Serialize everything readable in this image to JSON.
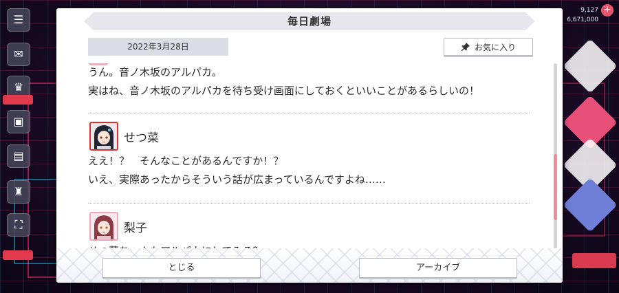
{
  "modal": {
    "title": "毎日劇場",
    "date": "2022年3月28日",
    "favorite_label": "お気に入り"
  },
  "dialogue": [
    {
      "speaker": "",
      "lines": [
        "うん。音ノ木坂のアルパカ。",
        "実はね、音ノ木坂のアルパカを待ち受け画面にしておくといいことがあるらしいの！"
      ]
    },
    {
      "speaker": "せつ菜",
      "avatar": "setsuna-avatar",
      "lines": [
        "ええ！？　そんなことがあるんですか！？",
        "いえ、実際あったからそういう話が広まっているんですよね……"
      ]
    },
    {
      "speaker": "梨子",
      "avatar": "riko-avatar",
      "lines": [
        "せつ菜ちゃんもアルパカにしてみる？"
      ]
    }
  ],
  "buttons": {
    "close_label": "とじる",
    "archive_label": "アーカイブ"
  },
  "background": {
    "stat_1": "9,127",
    "stat_2": "6,671,000"
  },
  "colors": {
    "accent_pink": "#ef8a97",
    "setsuna_frame": "#d8312f",
    "riko_frame": "#f0a7b3"
  }
}
